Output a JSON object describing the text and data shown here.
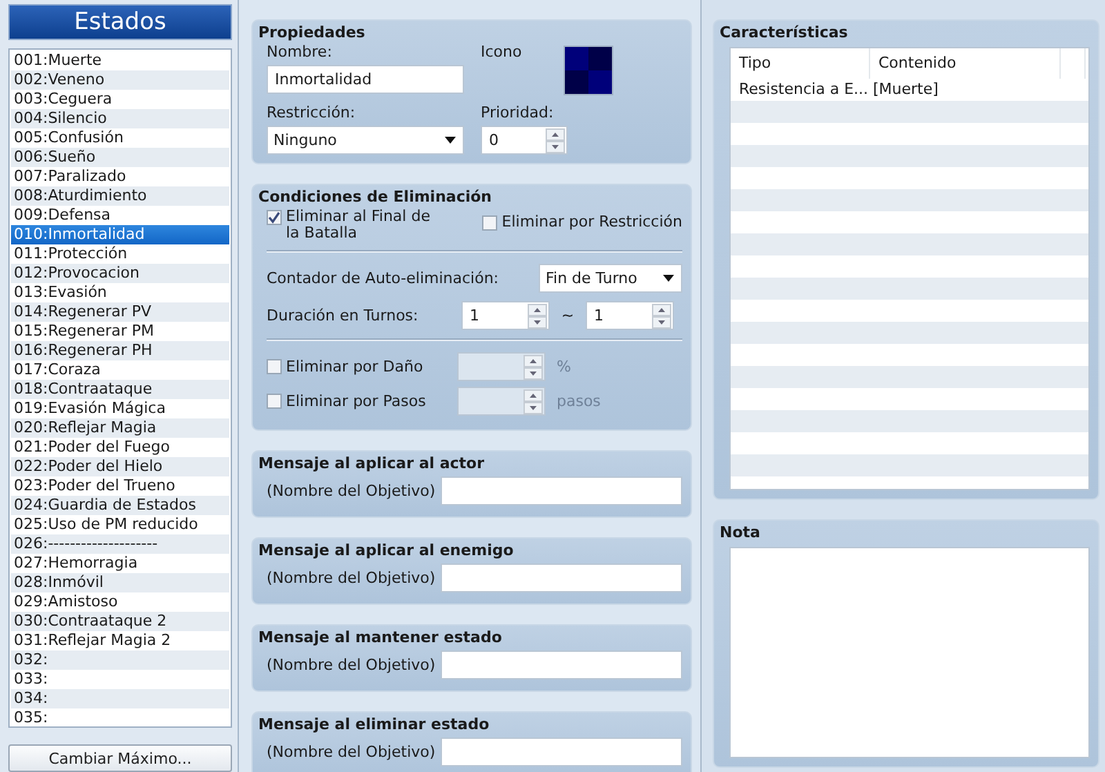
{
  "sidebar": {
    "title": "Estados",
    "items": [
      {
        "label": "001:Muerte",
        "selected": false
      },
      {
        "label": "002:Veneno",
        "selected": false
      },
      {
        "label": "003:Ceguera",
        "selected": false
      },
      {
        "label": "004:Silencio",
        "selected": false
      },
      {
        "label": "005:Confusión",
        "selected": false
      },
      {
        "label": "006:Sueño",
        "selected": false
      },
      {
        "label": "007:Paralizado",
        "selected": false
      },
      {
        "label": "008:Aturdimiento",
        "selected": false
      },
      {
        "label": "009:Defensa",
        "selected": false
      },
      {
        "label": "010:Inmortalidad",
        "selected": true
      },
      {
        "label": "011:Protección",
        "selected": false
      },
      {
        "label": "012:Provocacion",
        "selected": false
      },
      {
        "label": "013:Evasión",
        "selected": false
      },
      {
        "label": "014:Regenerar PV",
        "selected": false
      },
      {
        "label": "015:Regenerar PM",
        "selected": false
      },
      {
        "label": "016:Regenerar PH",
        "selected": false
      },
      {
        "label": "017:Coraza",
        "selected": false
      },
      {
        "label": "018:Contraataque",
        "selected": false
      },
      {
        "label": "019:Evasión Mágica",
        "selected": false
      },
      {
        "label": "020:Reflejar Magia",
        "selected": false
      },
      {
        "label": "021:Poder del Fuego",
        "selected": false
      },
      {
        "label": "022:Poder del Hielo",
        "selected": false
      },
      {
        "label": "023:Poder del Trueno",
        "selected": false
      },
      {
        "label": "024:Guardia de Estados",
        "selected": false
      },
      {
        "label": "025:Uso de PM reducido",
        "selected": false
      },
      {
        "label": "026:--------------------",
        "selected": false
      },
      {
        "label": "027:Hemorragia",
        "selected": false
      },
      {
        "label": "028:Inmóvil",
        "selected": false
      },
      {
        "label": "029:Amistoso",
        "selected": false
      },
      {
        "label": "030:Contraataque 2",
        "selected": false
      },
      {
        "label": "031:Reflejar Magia 2",
        "selected": false
      },
      {
        "label": "032:",
        "selected": false
      },
      {
        "label": "033:",
        "selected": false
      },
      {
        "label": "034:",
        "selected": false
      },
      {
        "label": "035:",
        "selected": false
      }
    ],
    "button": "Cambiar Máximo..."
  },
  "properties": {
    "title": "Propiedades",
    "name_label": "Nombre:",
    "name_value": "Inmortalidad",
    "icon_label": "Icono",
    "restriction_label": "Restricción:",
    "restriction_value": "Ninguno",
    "priority_label": "Prioridad:",
    "priority_value": "0"
  },
  "removal": {
    "title": "Condiciones de Eliminación",
    "top_checks": [
      {
        "label": "Eliminar al Final de la Batalla",
        "checked": true
      },
      {
        "label": "Eliminar por Restricción",
        "checked": false
      }
    ],
    "auto_label": "Contador de Auto-eliminación:",
    "auto_value": "Fin de Turno",
    "duration_label": "Duración en Turnos:",
    "duration_min": "1",
    "tilde": "~",
    "duration_max": "1",
    "bottom_checks": [
      {
        "label": "Eliminar por Daño",
        "checked": false,
        "unit": "%"
      },
      {
        "label": "Eliminar por Pasos",
        "checked": false,
        "unit": "pasos"
      }
    ]
  },
  "messages": [
    {
      "title": "Mensaje al aplicar al actor",
      "prefix": "(Nombre del Objetivo)"
    },
    {
      "title": "Mensaje al aplicar al enemigo",
      "prefix": "(Nombre del Objetivo)"
    },
    {
      "title": "Mensaje al mantener estado",
      "prefix": "(Nombre del Objetivo)"
    },
    {
      "title": "Mensaje al eliminar estado",
      "prefix": "(Nombre del Objetivo)"
    }
  ],
  "features": {
    "title": "Características",
    "columns": [
      "Tipo",
      "Contenido"
    ],
    "rows": [
      [
        "Resistencia a E...",
        "[Muerte]"
      ]
    ]
  },
  "note": {
    "title": "Nota"
  }
}
